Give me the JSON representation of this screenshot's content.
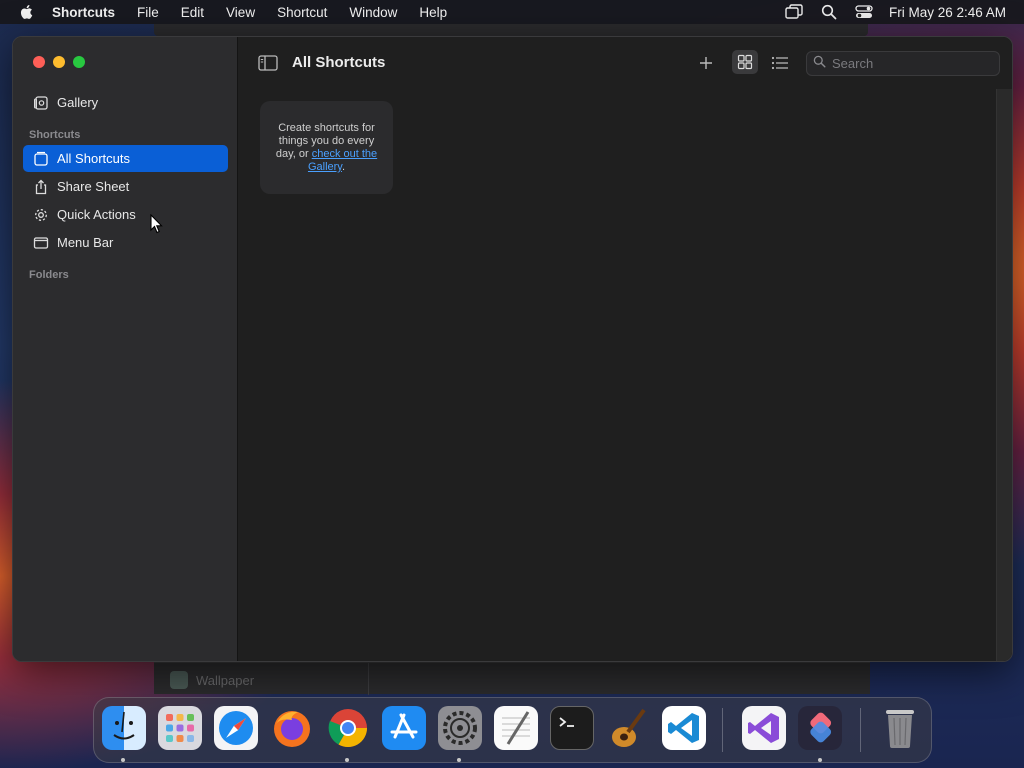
{
  "menubar": {
    "app_name": "Shortcuts",
    "menus": [
      "File",
      "Edit",
      "View",
      "Shortcut",
      "Window",
      "Help"
    ],
    "clock": "Fri May 26  2:46 AM"
  },
  "background_window": {
    "label": "Wallpaper"
  },
  "sidebar": {
    "gallery": "Gallery",
    "shortcuts_section": "Shortcuts",
    "items": [
      {
        "label": "All Shortcuts",
        "icon": "shortcuts-stack-icon",
        "active": true
      },
      {
        "label": "Share Sheet",
        "icon": "share-icon",
        "active": false
      },
      {
        "label": "Quick Actions",
        "icon": "gear-icon",
        "active": false
      },
      {
        "label": "Menu Bar",
        "icon": "menubar-icon",
        "active": false
      }
    ],
    "folders_section": "Folders"
  },
  "content": {
    "title": "All Shortcuts",
    "search_placeholder": "Search",
    "empty": {
      "text": "Create shortcuts for things you do every day, or ",
      "link": "check out the Gallery",
      "suffix": "."
    }
  },
  "dock": {
    "apps": [
      "Finder",
      "Launchpad",
      "Safari",
      "Firefox",
      "Chrome",
      "App Store",
      "System Settings",
      "TextEdit",
      "Terminal",
      "GarageBand",
      "Visual Studio Code",
      "Visual Studio",
      "Shortcuts",
      "Trash"
    ]
  },
  "colors": {
    "accent": "#0a5fd6",
    "link": "#4aa0ff",
    "close": "#fe5f57",
    "minimize": "#febc2e",
    "zoom": "#28c840"
  }
}
